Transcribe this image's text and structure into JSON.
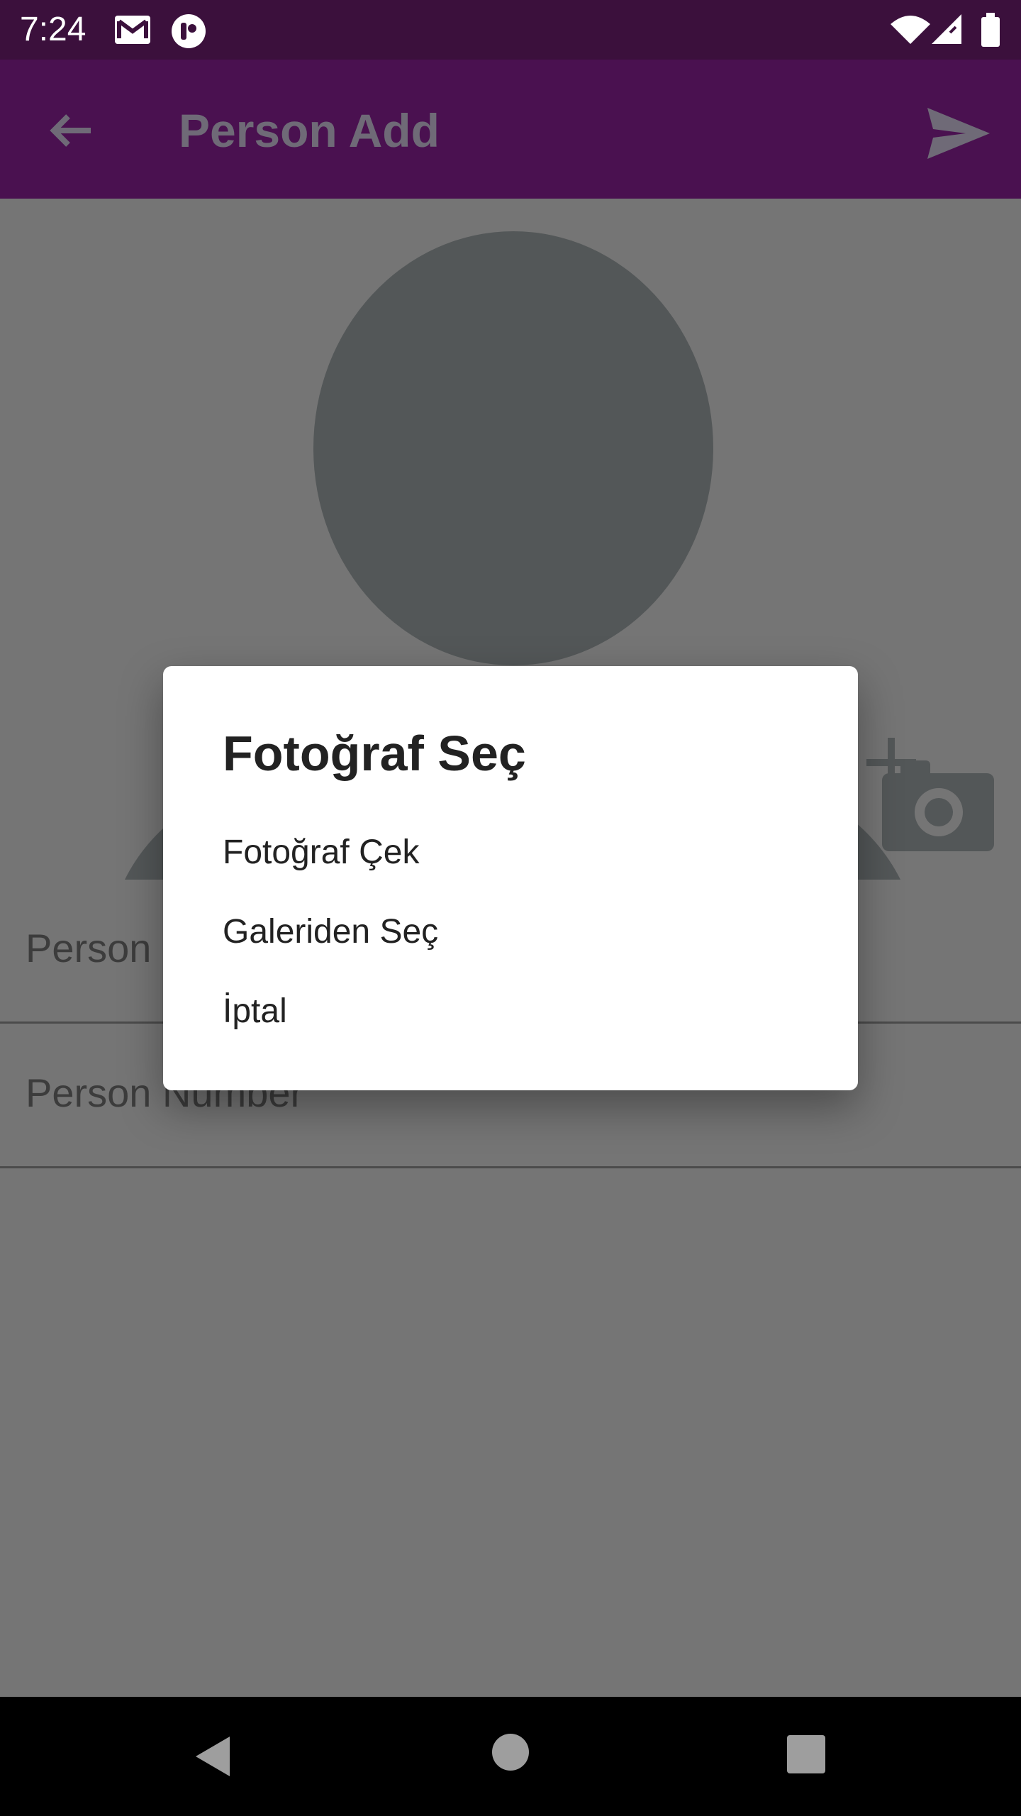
{
  "status_bar": {
    "time": "7:24",
    "left_icons": [
      "gmail-icon",
      "app-notification-icon"
    ],
    "right_icons": [
      "wifi-icon",
      "cellular-signal-icon",
      "battery-icon"
    ]
  },
  "app_bar": {
    "title": "Person Add",
    "back_icon": "arrow-back-icon",
    "send_icon": "send-icon",
    "color": "#4a1150"
  },
  "form": {
    "name_label": "Person Name",
    "number_label": "Person Number"
  },
  "dialog": {
    "title": "Fotoğraf Seç",
    "options": [
      "Fotoğraf Çek",
      "Galeriden Seç",
      "İptal"
    ]
  },
  "nav_bar": {
    "icons": [
      "nav-back-icon",
      "nav-home-icon",
      "nav-recents-icon"
    ]
  },
  "colors": {
    "status_bar": "#3b103c",
    "app_bar": "#4a1150",
    "scrim": "#757575",
    "dialog": "#ffffff"
  }
}
